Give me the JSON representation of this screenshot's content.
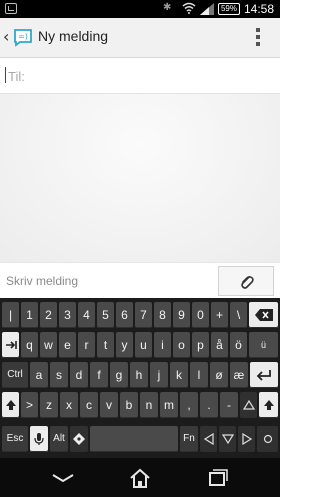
{
  "status_bar": {
    "battery_label": "59%",
    "time": "14:58"
  },
  "action_bar": {
    "title": "Ny melding"
  },
  "recipient": {
    "placeholder": "Til:"
  },
  "compose": {
    "placeholder": "Skriv melding"
  },
  "keyboard": {
    "row1": [
      "|",
      "1",
      "2",
      "3",
      "4",
      "5",
      "6",
      "7",
      "8",
      "9",
      "0",
      "+",
      "\\"
    ],
    "row2": [
      "q",
      "w",
      "e",
      "r",
      "t",
      "y",
      "u",
      "i",
      "o",
      "p",
      "å",
      "ö"
    ],
    "row3_label_ctrl": "Ctrl",
    "row3": [
      "a",
      "s",
      "d",
      "f",
      "g",
      "h",
      "j",
      "k",
      "l",
      "ø",
      "æ"
    ],
    "row4_left": ">",
    "row4": [
      "z",
      "x",
      "c",
      "v",
      "b",
      "n",
      "m",
      ",",
      ".",
      "-"
    ],
    "row5_esc": "Esc",
    "row5_alt": "Alt",
    "row5_fn": "Fn",
    "row2_sub_label": "ü"
  },
  "icons": {
    "back": "chevron-left-icon",
    "app_logo": "messaging-app-icon",
    "overflow": "more-vert-icon",
    "attach": "paperclip-icon",
    "backspace": "backspace-icon",
    "tab": "tab-icon",
    "enter": "enter-icon",
    "shift": "shift-icon",
    "mic": "mic-icon",
    "settings": "settings-icon",
    "arrows": "arrow-keys-icon",
    "nav_back": "nav-back-icon",
    "nav_home": "nav-home-icon",
    "nav_recents": "nav-recents-icon"
  },
  "colors": {
    "keyboard_bg": "#1c1c1c",
    "key_bg": "#4a4a4a",
    "accent_logo": "#33a6c9"
  }
}
